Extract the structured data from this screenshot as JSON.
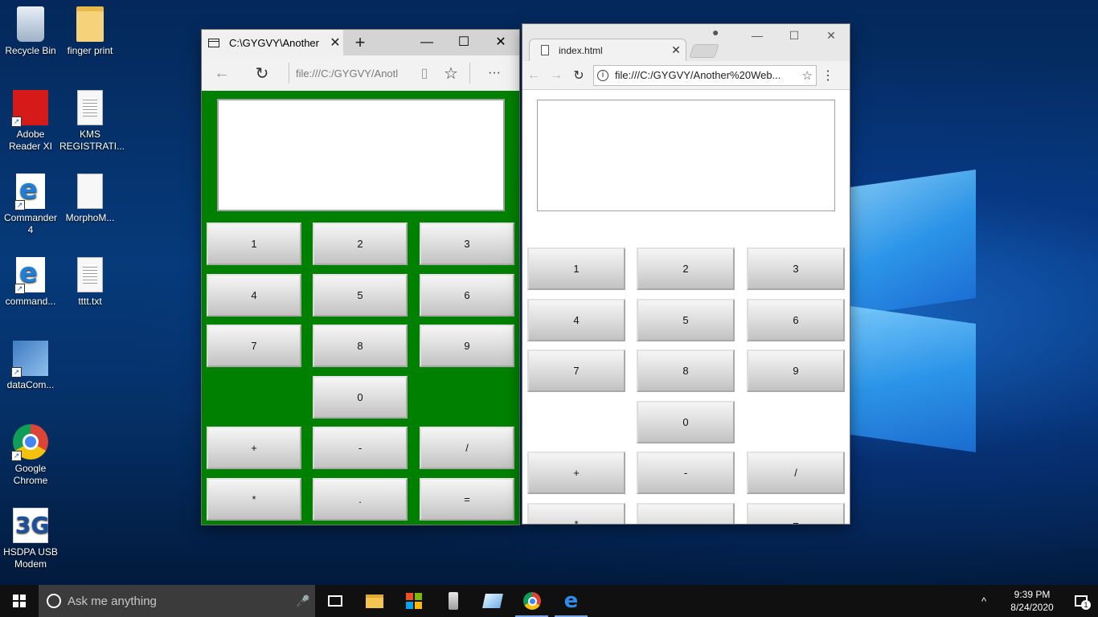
{
  "desktop": {
    "icons": [
      {
        "label": "Recycle Bin"
      },
      {
        "label": "finger print"
      },
      {
        "label": "Adobe Reader XI"
      },
      {
        "label": "KMS REGISTRATI..."
      },
      {
        "label": "Commander 4"
      },
      {
        "label": "MorphoM..."
      },
      {
        "label": "command..."
      },
      {
        "label": "tttt.txt"
      },
      {
        "label": "dataCom..."
      },
      {
        "label": "Google Chrome"
      },
      {
        "label": "HSDPA USB Modem"
      }
    ]
  },
  "edge_window": {
    "tab_title": "C:\\GYGVY\\Another",
    "close_glyph": "✕",
    "newtab_glyph": "+",
    "caption": {
      "minimize": "—",
      "maximize": "☐",
      "close": "✕"
    },
    "nav": {
      "back": "←",
      "refresh": "↻",
      "reading": "▯",
      "favorite": "☆",
      "more": "···"
    },
    "address": "file:///C:/GYGVY/Anotl"
  },
  "chrome_window": {
    "tab_title": "index.html",
    "close_glyph": "✕",
    "profile_glyph": "●",
    "caption": {
      "minimize": "—",
      "maximize": "☐",
      "close": "✕"
    },
    "nav": {
      "back": "←",
      "forward": "→",
      "reload": "↻",
      "star": "☆",
      "menu": "⋮"
    },
    "info_glyph": "i",
    "url": "file:///C:/GYGVY/Another%20Web..."
  },
  "calculator": {
    "buttons": [
      [
        "1",
        "2",
        "3"
      ],
      [
        "4",
        "5",
        "6"
      ],
      [
        "7",
        "8",
        "9"
      ],
      [
        "",
        "0",
        ""
      ],
      [
        "+",
        "-",
        "/"
      ],
      [
        "*",
        ".",
        "="
      ]
    ]
  },
  "taskbar": {
    "search_placeholder": "Ask me anything",
    "mic_glyph": "🎤",
    "tray_chevron": "^",
    "time": "9:39 PM",
    "date": "8/24/2020",
    "notification_count": "1",
    "store_colors": [
      "#f25022",
      "#7fba00",
      "#00a4ef",
      "#ffb900"
    ]
  }
}
